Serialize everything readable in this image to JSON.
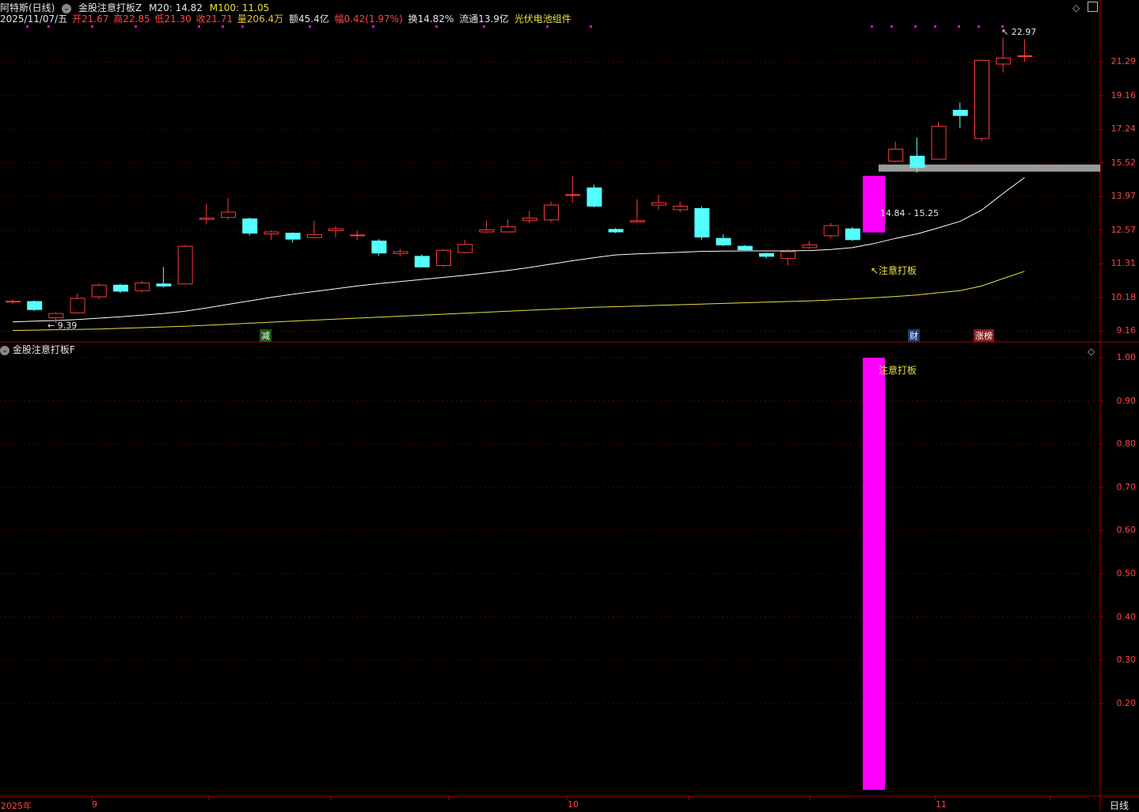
{
  "header": {
    "title": "阿特斯(日线)",
    "indicator_name": "金股注意打板Z",
    "m20_label": "M20: 14.82",
    "m100_label": "M100: 11.05",
    "date": "2025/11/07/五",
    "open": "开21.67",
    "high": "高22.85",
    "low": "低21.30",
    "close": "收21.71",
    "volume": "量206.4万",
    "amount": "额45.4亿",
    "change": "幅0.42(1.97%)",
    "turnover": "换14.82%",
    "float": "流通13.9亿",
    "sector": "光伏电池组件"
  },
  "sub_panel": {
    "title": "金股注意打板F"
  },
  "price_axis": [
    "21.29",
    "19.16",
    "17.24",
    "15.52",
    "13.97",
    "12.57",
    "11.31",
    "10.18",
    "9.16"
  ],
  "sub_axis": [
    "1.00",
    "0.90",
    "0.80",
    "0.70",
    "0.60",
    "0.50",
    "0.40",
    "0.30",
    "0.20"
  ],
  "time_axis": {
    "year": "2025年",
    "sep": "9",
    "oct": "10",
    "nov": "11",
    "period": "日线"
  },
  "annotations": {
    "low_marker": "9.39",
    "high_marker": "22.97",
    "zone_range": "14.84 - 15.25",
    "signal_main": "↖注意打板",
    "signal_sub": "注意打板",
    "tag_jian": "减",
    "tag_cai": "财",
    "tag_zhangbang": "涨榜"
  },
  "colors": {
    "up": "#ff3b3b",
    "down": "#54ffff",
    "ma20": "#ffffff",
    "ma100": "#e8e040",
    "signal": "#ff00ff",
    "zone": "#9a9a9a",
    "grid": "#5a0000"
  },
  "chart_data": {
    "type": "candlestick",
    "price_scale": "log",
    "ylim": [
      8.9,
      24.0
    ],
    "candles": [
      {
        "o": 10.05,
        "h": 10.12,
        "l": 9.98,
        "c": 10.06
      },
      {
        "o": 10.05,
        "h": 10.08,
        "l": 9.75,
        "c": 9.8
      },
      {
        "o": 9.55,
        "h": 9.72,
        "l": 9.39,
        "c": 9.68
      },
      {
        "o": 9.7,
        "h": 10.3,
        "l": 9.68,
        "c": 10.15
      },
      {
        "o": 10.2,
        "h": 10.65,
        "l": 10.12,
        "c": 10.58
      },
      {
        "o": 10.58,
        "h": 10.62,
        "l": 10.32,
        "c": 10.38
      },
      {
        "o": 10.4,
        "h": 10.72,
        "l": 10.35,
        "c": 10.65
      },
      {
        "o": 10.62,
        "h": 11.2,
        "l": 10.5,
        "c": 10.55
      },
      {
        "o": 10.62,
        "h": 12.0,
        "l": 10.6,
        "c": 11.95
      },
      {
        "o": 13.0,
        "h": 13.65,
        "l": 12.8,
        "c": 13.05
      },
      {
        "o": 13.08,
        "h": 13.9,
        "l": 12.98,
        "c": 13.3
      },
      {
        "o": 13.02,
        "h": 13.08,
        "l": 12.35,
        "c": 12.45
      },
      {
        "o": 12.42,
        "h": 12.55,
        "l": 12.18,
        "c": 12.5
      },
      {
        "o": 12.45,
        "h": 12.48,
        "l": 12.08,
        "c": 12.22
      },
      {
        "o": 12.28,
        "h": 12.95,
        "l": 12.25,
        "c": 12.4
      },
      {
        "o": 12.55,
        "h": 12.72,
        "l": 12.3,
        "c": 12.62
      },
      {
        "o": 12.35,
        "h": 12.55,
        "l": 12.18,
        "c": 12.38
      },
      {
        "o": 12.15,
        "h": 12.22,
        "l": 11.6,
        "c": 11.7
      },
      {
        "o": 11.68,
        "h": 11.85,
        "l": 11.58,
        "c": 11.75
      },
      {
        "o": 11.58,
        "h": 11.65,
        "l": 11.18,
        "c": 11.2
      },
      {
        "o": 11.25,
        "h": 11.85,
        "l": 11.2,
        "c": 11.8
      },
      {
        "o": 11.72,
        "h": 12.2,
        "l": 11.68,
        "c": 12.02
      },
      {
        "o": 12.5,
        "h": 12.95,
        "l": 12.45,
        "c": 12.58
      },
      {
        "o": 12.5,
        "h": 13.0,
        "l": 12.48,
        "c": 12.7
      },
      {
        "o": 12.95,
        "h": 13.35,
        "l": 12.85,
        "c": 13.05
      },
      {
        "o": 12.98,
        "h": 13.75,
        "l": 12.88,
        "c": 13.6
      },
      {
        "o": 14.05,
        "h": 14.9,
        "l": 13.7,
        "c": 14.05
      },
      {
        "o": 14.35,
        "h": 14.5,
        "l": 13.5,
        "c": 13.55
      },
      {
        "o": 12.6,
        "h": 12.65,
        "l": 12.45,
        "c": 12.5
      },
      {
        "o": 12.9,
        "h": 13.85,
        "l": 12.88,
        "c": 12.95
      },
      {
        "o": 13.6,
        "h": 14.05,
        "l": 13.4,
        "c": 13.7
      },
      {
        "o": 13.4,
        "h": 13.75,
        "l": 13.3,
        "c": 13.55
      },
      {
        "o": 13.45,
        "h": 13.55,
        "l": 12.2,
        "c": 12.3
      },
      {
        "o": 12.25,
        "h": 12.4,
        "l": 11.95,
        "c": 12.0
      },
      {
        "o": 11.95,
        "h": 12.0,
        "l": 11.78,
        "c": 11.82
      },
      {
        "o": 11.68,
        "h": 11.72,
        "l": 11.5,
        "c": 11.58
      },
      {
        "o": 11.5,
        "h": 11.85,
        "l": 11.25,
        "c": 11.75
      },
      {
        "o": 11.9,
        "h": 12.15,
        "l": 11.85,
        "c": 12.0
      },
      {
        "o": 12.35,
        "h": 12.85,
        "l": 12.25,
        "c": 12.75
      },
      {
        "o": 12.62,
        "h": 12.7,
        "l": 12.15,
        "c": 12.2
      },
      {
        "o": 14.9,
        "h": 14.9,
        "l": 12.48,
        "c": 12.48
      },
      {
        "o": 15.6,
        "h": 16.6,
        "l": 15.55,
        "c": 16.2
      },
      {
        "o": 15.85,
        "h": 16.8,
        "l": 15.05,
        "c": 15.3
      },
      {
        "o": 15.7,
        "h": 17.65,
        "l": 15.7,
        "c": 17.4
      },
      {
        "o": 18.3,
        "h": 18.75,
        "l": 17.3,
        "c": 18.0
      },
      {
        "o": 16.75,
        "h": 21.45,
        "l": 16.6,
        "c": 21.4
      },
      {
        "o": 21.15,
        "h": 22.97,
        "l": 20.6,
        "c": 21.55
      },
      {
        "o": 21.67,
        "h": 22.85,
        "l": 21.3,
        "c": 21.71
      }
    ],
    "ma20": [
      9.43,
      9.45,
      9.47,
      9.5,
      9.54,
      9.58,
      9.63,
      9.68,
      9.75,
      9.85,
      9.96,
      10.07,
      10.18,
      10.28,
      10.37,
      10.46,
      10.55,
      10.63,
      10.7,
      10.77,
      10.84,
      10.91,
      10.99,
      11.08,
      11.18,
      11.3,
      11.42,
      11.53,
      11.63,
      11.67,
      11.7,
      11.73,
      11.76,
      11.77,
      11.78,
      11.78,
      11.78,
      11.79,
      11.83,
      11.9,
      12.05,
      12.25,
      12.42,
      12.66,
      12.92,
      13.38,
      14.1,
      14.82
    ],
    "ma100": [
      9.18,
      9.19,
      9.2,
      9.21,
      9.22,
      9.24,
      9.26,
      9.28,
      9.3,
      9.33,
      9.36,
      9.39,
      9.42,
      9.45,
      9.48,
      9.51,
      9.54,
      9.57,
      9.6,
      9.63,
      9.66,
      9.69,
      9.72,
      9.75,
      9.78,
      9.81,
      9.84,
      9.87,
      9.89,
      9.91,
      9.93,
      9.95,
      9.97,
      9.99,
      10.01,
      10.03,
      10.05,
      10.07,
      10.1,
      10.13,
      10.17,
      10.21,
      10.26,
      10.33,
      10.4,
      10.55,
      10.8,
      11.05
    ],
    "signal_index": 40,
    "signal_value": 1.0,
    "zone": [
      14.84,
      15.25
    ],
    "sub_ylim": [
      0.0,
      1.0
    ]
  }
}
